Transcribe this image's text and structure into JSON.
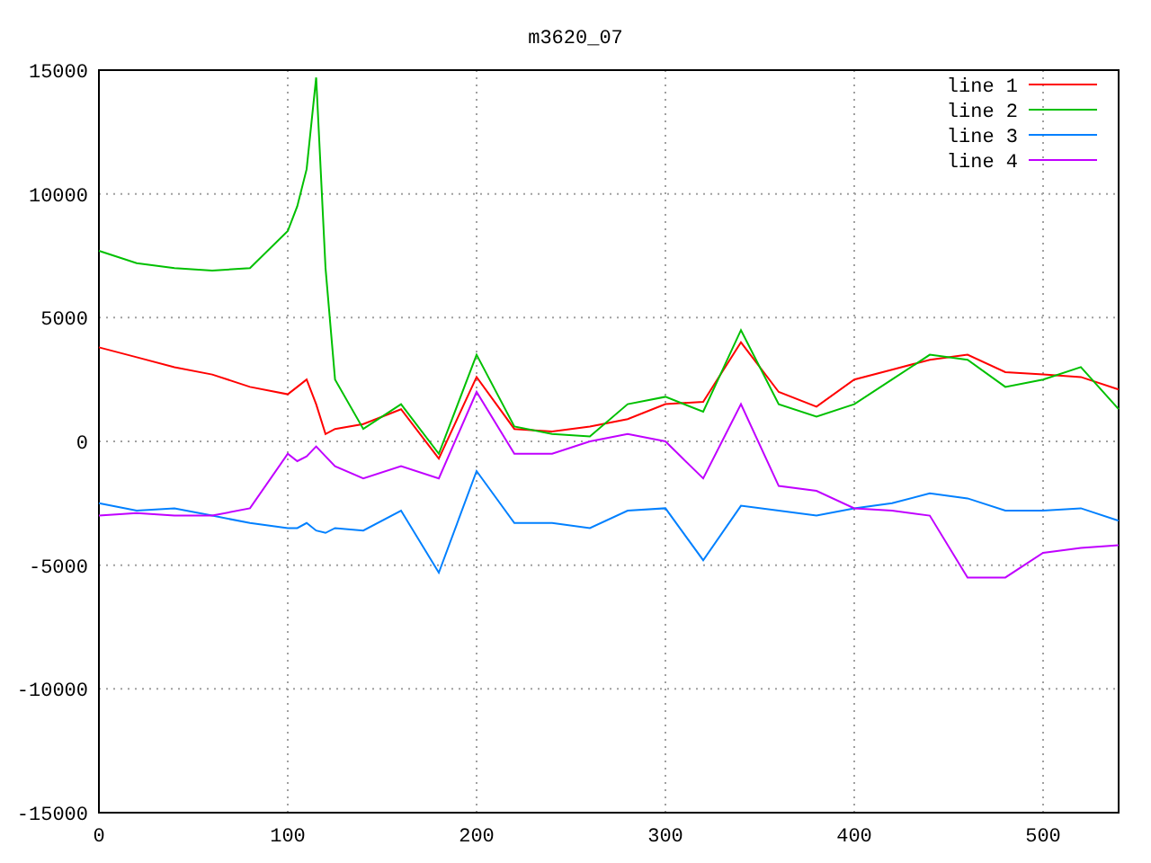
{
  "chart": {
    "chart_data": {
      "type": "line",
      "title": "m3620_07",
      "x": [
        0,
        20,
        40,
        60,
        80,
        100,
        105,
        110,
        115,
        120,
        125,
        140,
        160,
        180,
        200,
        220,
        240,
        260,
        280,
        300,
        320,
        340,
        360,
        380,
        400,
        420,
        440,
        460,
        480,
        500,
        520,
        540
      ],
      "series": [
        {
          "name": "line 1",
          "color": "#ff0000",
          "values": [
            3800,
            3400,
            3000,
            2700,
            2200,
            1900,
            2200,
            2500,
            1500,
            300,
            500,
            700,
            1300,
            -700,
            2600,
            500,
            400,
            600,
            900,
            1500,
            1600,
            4000,
            2000,
            1400,
            2500,
            2900,
            3300,
            3500,
            2800,
            2700,
            2600,
            2100
          ]
        },
        {
          "name": "line 2",
          "color": "#00c000",
          "values": [
            7700,
            7200,
            7000,
            6900,
            7000,
            8500,
            9500,
            11000,
            14700,
            7000,
            2500,
            500,
            1500,
            -500,
            3500,
            600,
            300,
            200,
            1500,
            1800,
            1200,
            4500,
            1500,
            1000,
            1500,
            2500,
            3500,
            3300,
            2200,
            2500,
            3000,
            1300
          ]
        },
        {
          "name": "line 3",
          "color": "#0080ff",
          "values": [
            -2500,
            -2800,
            -2700,
            -3000,
            -3300,
            -3500,
            -3500,
            -3300,
            -3600,
            -3700,
            -3500,
            -3600,
            -2800,
            -5300,
            -1200,
            -3300,
            -3300,
            -3500,
            -2800,
            -2700,
            -4800,
            -2600,
            -2800,
            -3000,
            -2700,
            -2500,
            -2100,
            -2300,
            -2800,
            -2800,
            -2700,
            -3200
          ]
        },
        {
          "name": "line 4",
          "color": "#c000ff",
          "values": [
            -3000,
            -2900,
            -3000,
            -3000,
            -2700,
            -500,
            -800,
            -600,
            -200,
            -600,
            -1000,
            -1500,
            -1000,
            -1500,
            2000,
            -500,
            -500,
            0,
            300,
            0,
            -1500,
            1500,
            -1800,
            -2000,
            -2700,
            -2800,
            -3000,
            -5500,
            -5500,
            -4500,
            -4300,
            -4200
          ]
        }
      ],
      "grid": true,
      "legend": true,
      "xlim": [
        0,
        540
      ],
      "ylim": [
        -15000,
        15000
      ],
      "xticks": [
        0,
        100,
        200,
        300,
        400,
        500
      ],
      "yticks": [
        -15000,
        -10000,
        -5000,
        0,
        5000,
        10000,
        15000
      ]
    }
  }
}
